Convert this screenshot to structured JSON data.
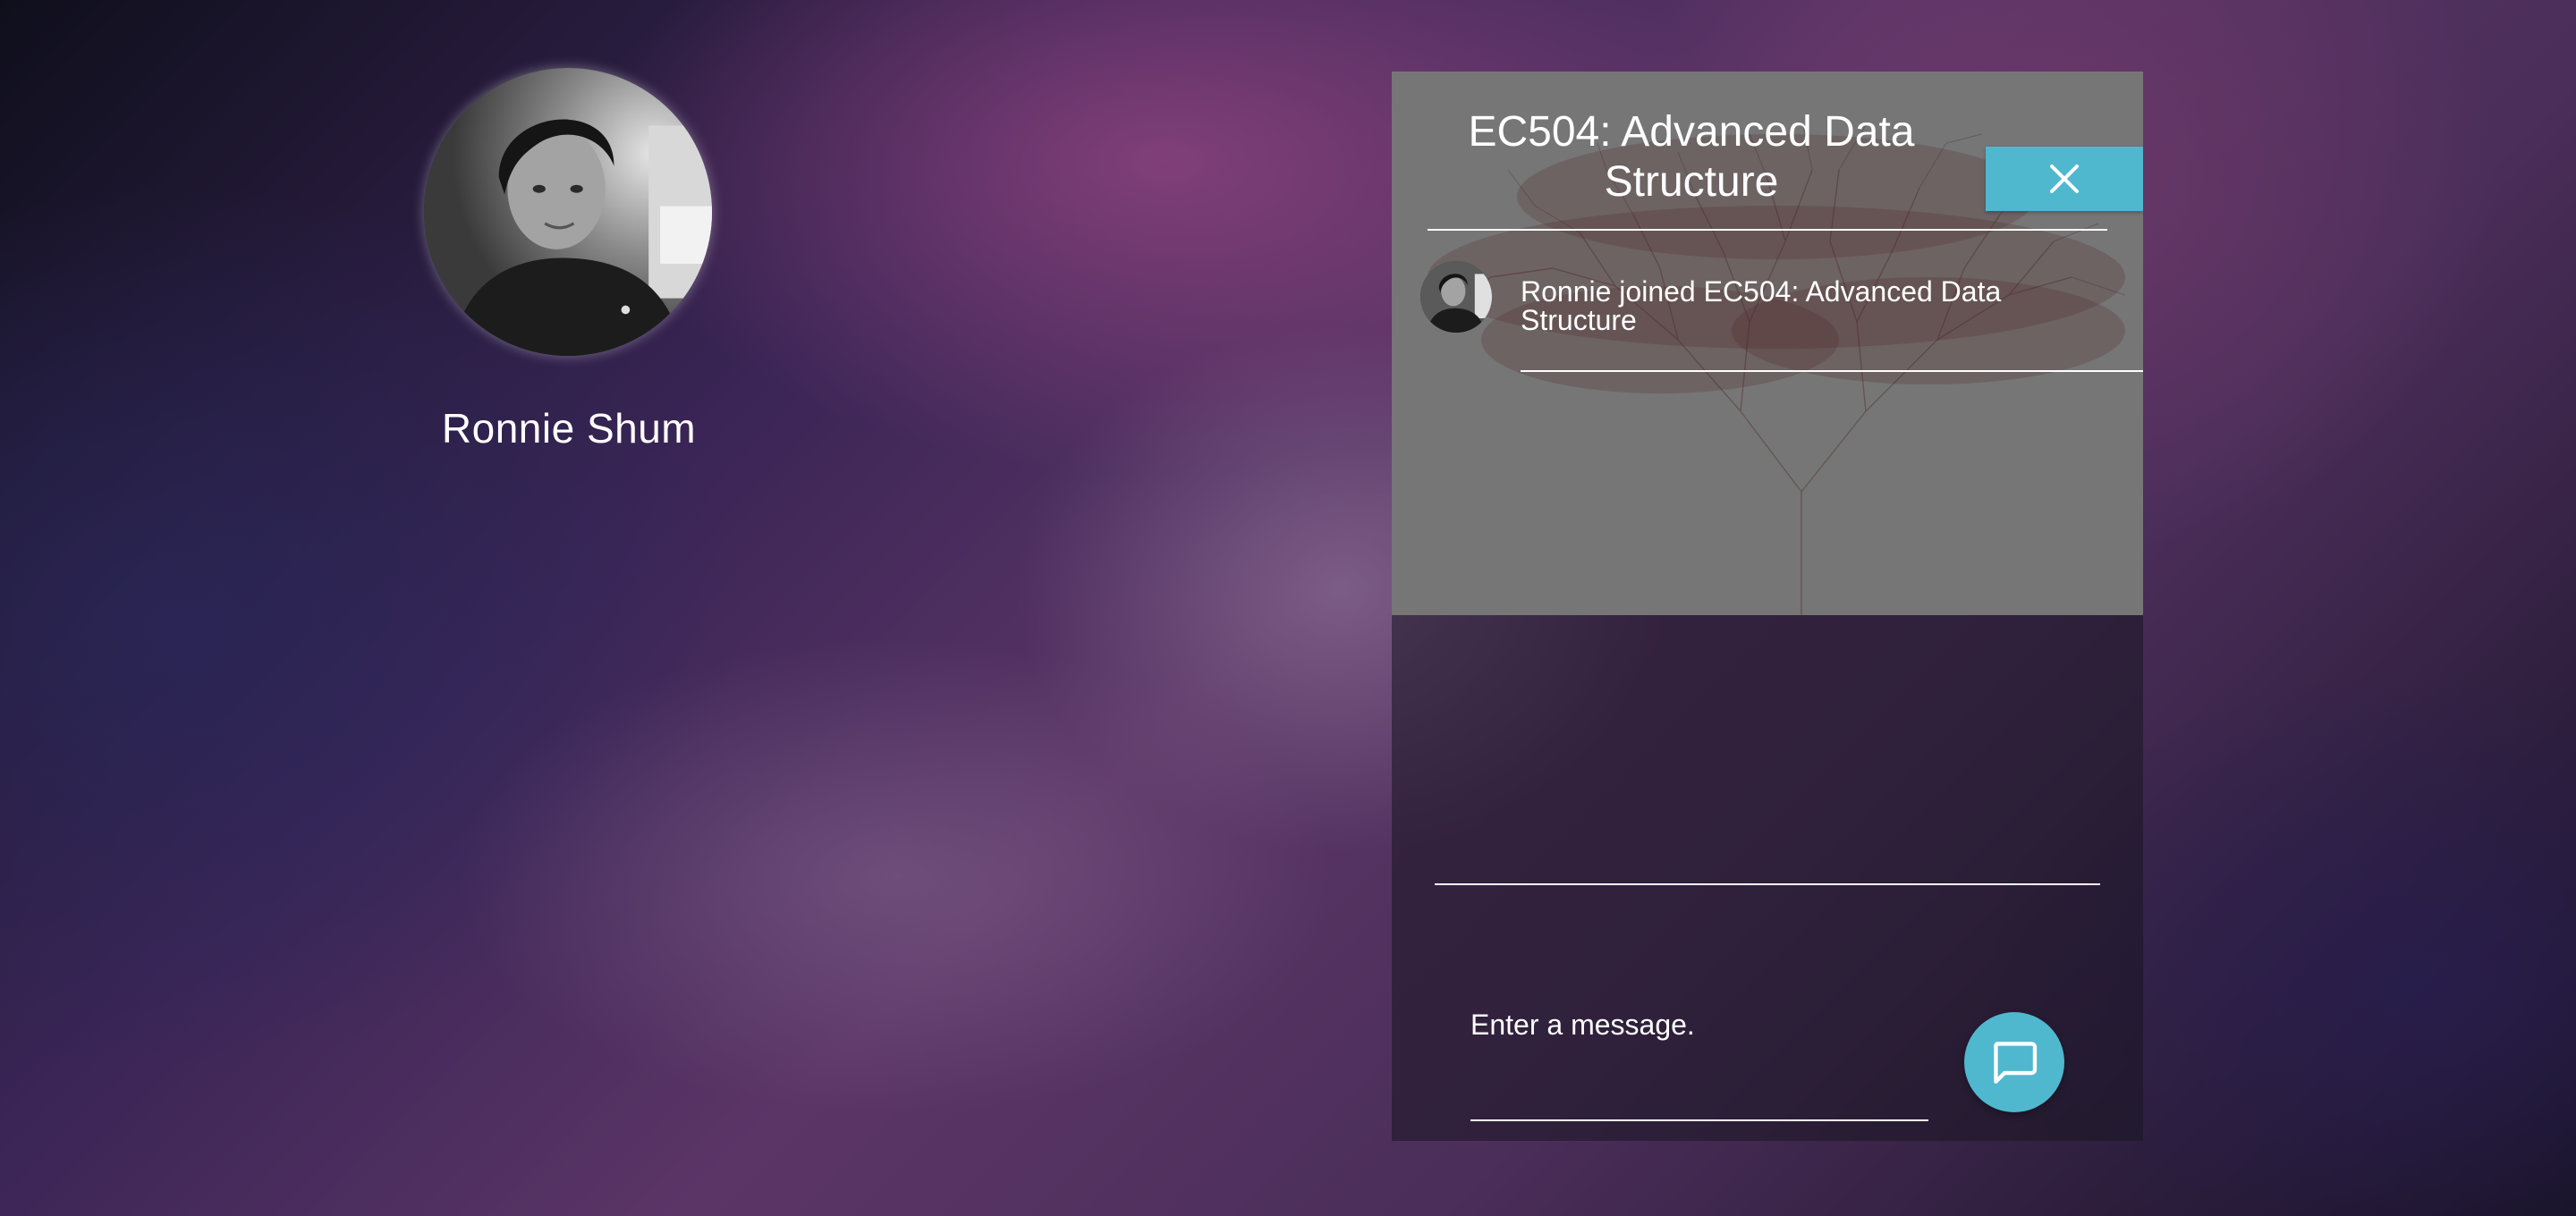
{
  "profile": {
    "name": "Ronnie Shum",
    "avatar_icon": "user-photo"
  },
  "chat": {
    "title": "EC504: Advanced Data Structure",
    "close_icon": "close-icon",
    "activity": [
      {
        "text": "Ronnie joined EC504: Advanced Data Structure",
        "avatar_icon": "user-photo"
      }
    ],
    "message_placeholder": "Enter a message.",
    "send_icon": "chat-bubble-icon"
  },
  "colors": {
    "accent": "#4fb8cf",
    "panel_top": "#767676",
    "text": "#ffffff"
  }
}
